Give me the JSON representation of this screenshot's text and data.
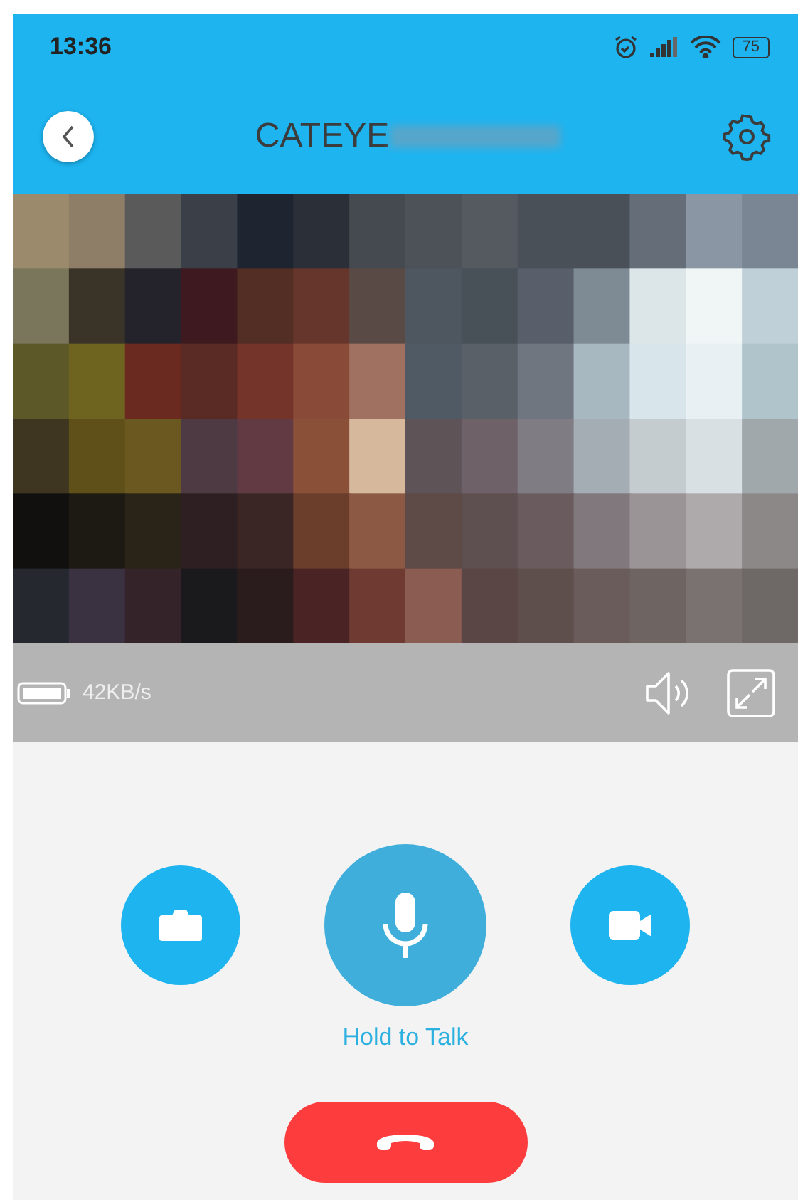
{
  "status_bar": {
    "time": "13:36",
    "battery": "75"
  },
  "header": {
    "title": "CATEYE"
  },
  "video_bar": {
    "speed": "42KB/s"
  },
  "controls": {
    "talk_label": "Hold to Talk"
  }
}
